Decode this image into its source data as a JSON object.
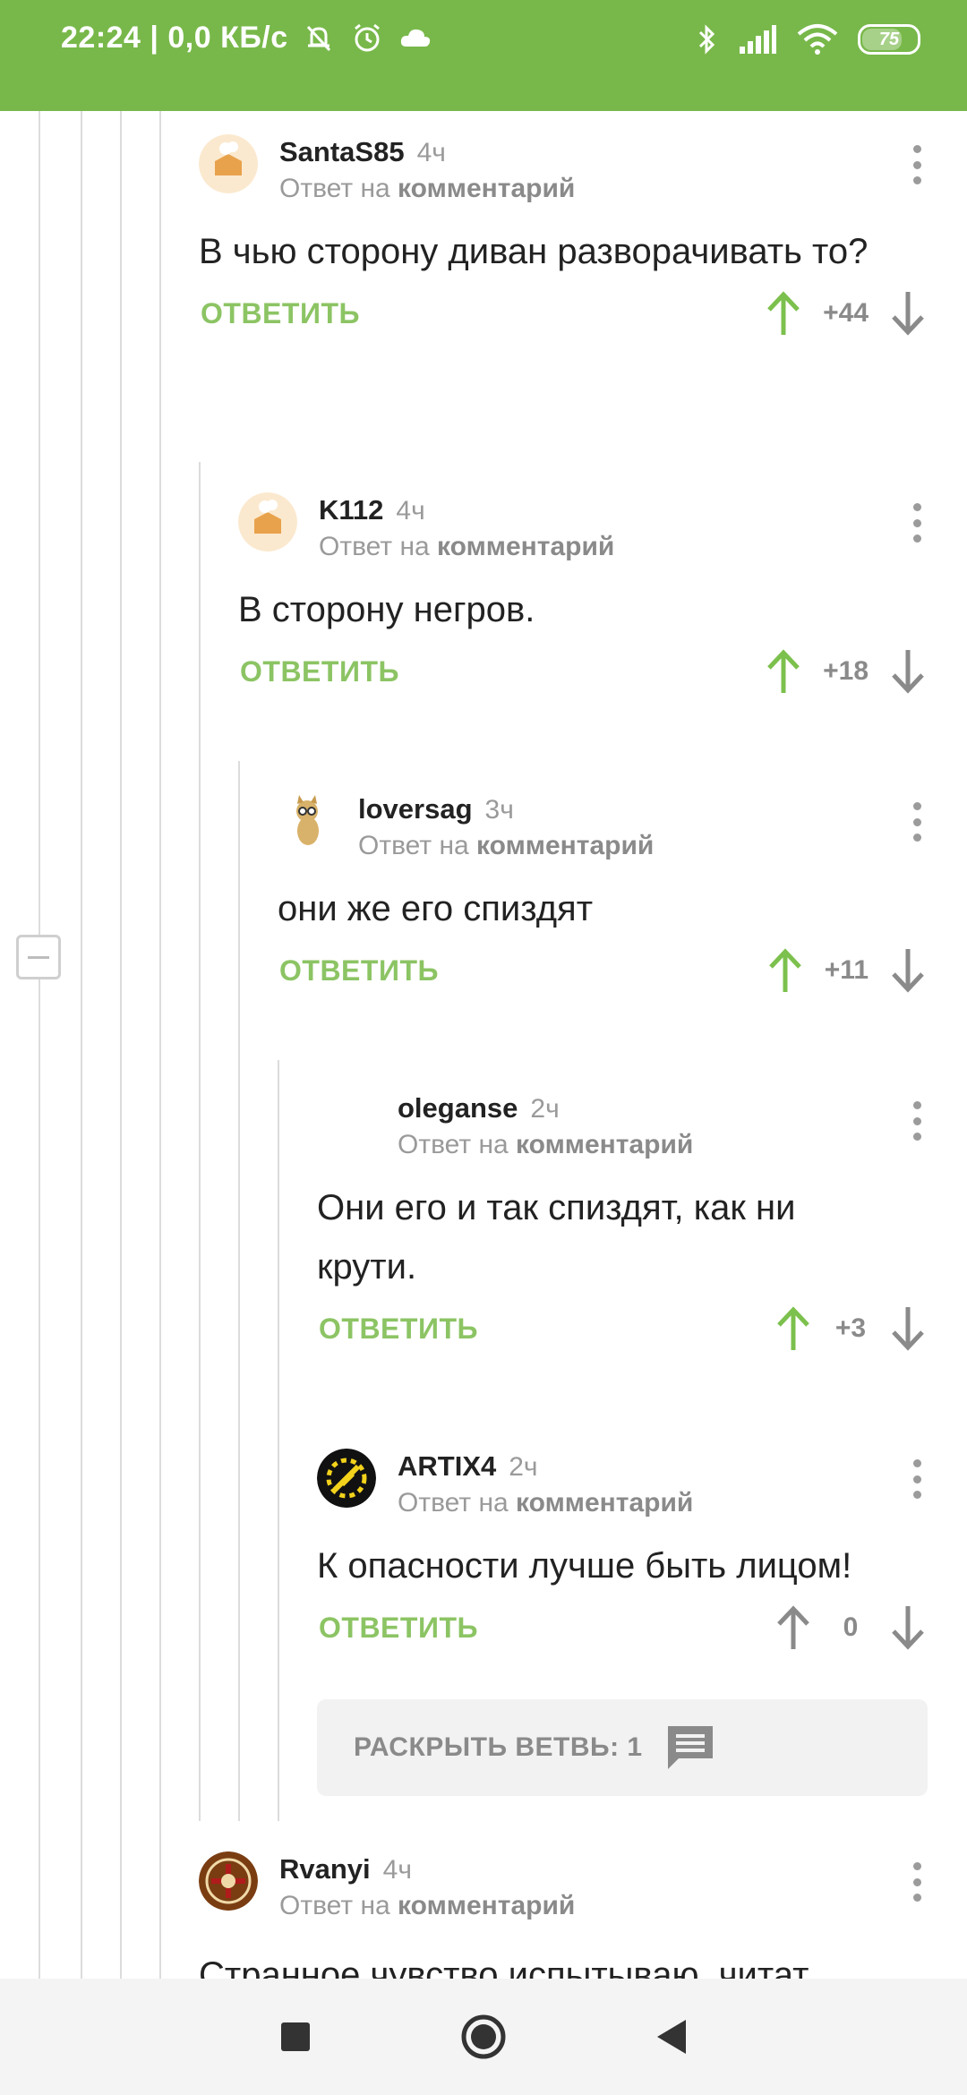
{
  "status_bar": {
    "time_speed": "22:24 | 0,0 КБ/с",
    "battery": "75",
    "battery_level": 0.75,
    "icons": [
      "mute-bell-icon",
      "alarm-icon",
      "cloud-icon",
      "bluetooth-icon",
      "signal-icon",
      "wifi-icon",
      "battery-icon"
    ]
  },
  "colors": {
    "accent": "#78b84a",
    "link": "#8cc464"
  },
  "comments": [
    {
      "user": "SantaS85",
      "time": "4ч",
      "reply_prefix": "Ответ на",
      "reply_target": "комментарий",
      "text": "В чью сторону диван разворачивать то?",
      "reply_label": "ОТВЕТИТЬ",
      "score": "+44"
    },
    {
      "user": "K112",
      "time": "4ч",
      "reply_prefix": "Ответ на",
      "reply_target": "комментарий",
      "text": "В сторону негров.",
      "reply_label": "ОТВЕТИТЬ",
      "score": "+18"
    },
    {
      "user": "loversag",
      "time": "3ч",
      "reply_prefix": "Ответ на",
      "reply_target": "комментарий",
      "text": "они же его спиздят",
      "reply_label": "ОТВЕТИТЬ",
      "score": "+11"
    },
    {
      "user": "oleganse",
      "time": "2ч",
      "reply_prefix": "Ответ на",
      "reply_target": "комментарий",
      "text": "Они его и так спиздят, как ни крути.",
      "reply_label": "ОТВЕТИТЬ",
      "score": "+3"
    },
    {
      "user": "ARTIX4",
      "time": "2ч",
      "reply_prefix": "Ответ на",
      "reply_target": "комментарий",
      "text": "К опасности лучше быть лицом!",
      "reply_label": "ОТВЕТИТЬ",
      "score": "0"
    },
    {
      "user": "Rvanyi",
      "time": "4ч",
      "reply_prefix": "Ответ на",
      "reply_target": "комментарий",
      "text": "Странное чувство испытываю, читат"
    }
  ],
  "expand_branch": {
    "label": "РАСКРЫТЬ ВЕТВЬ: 1"
  }
}
